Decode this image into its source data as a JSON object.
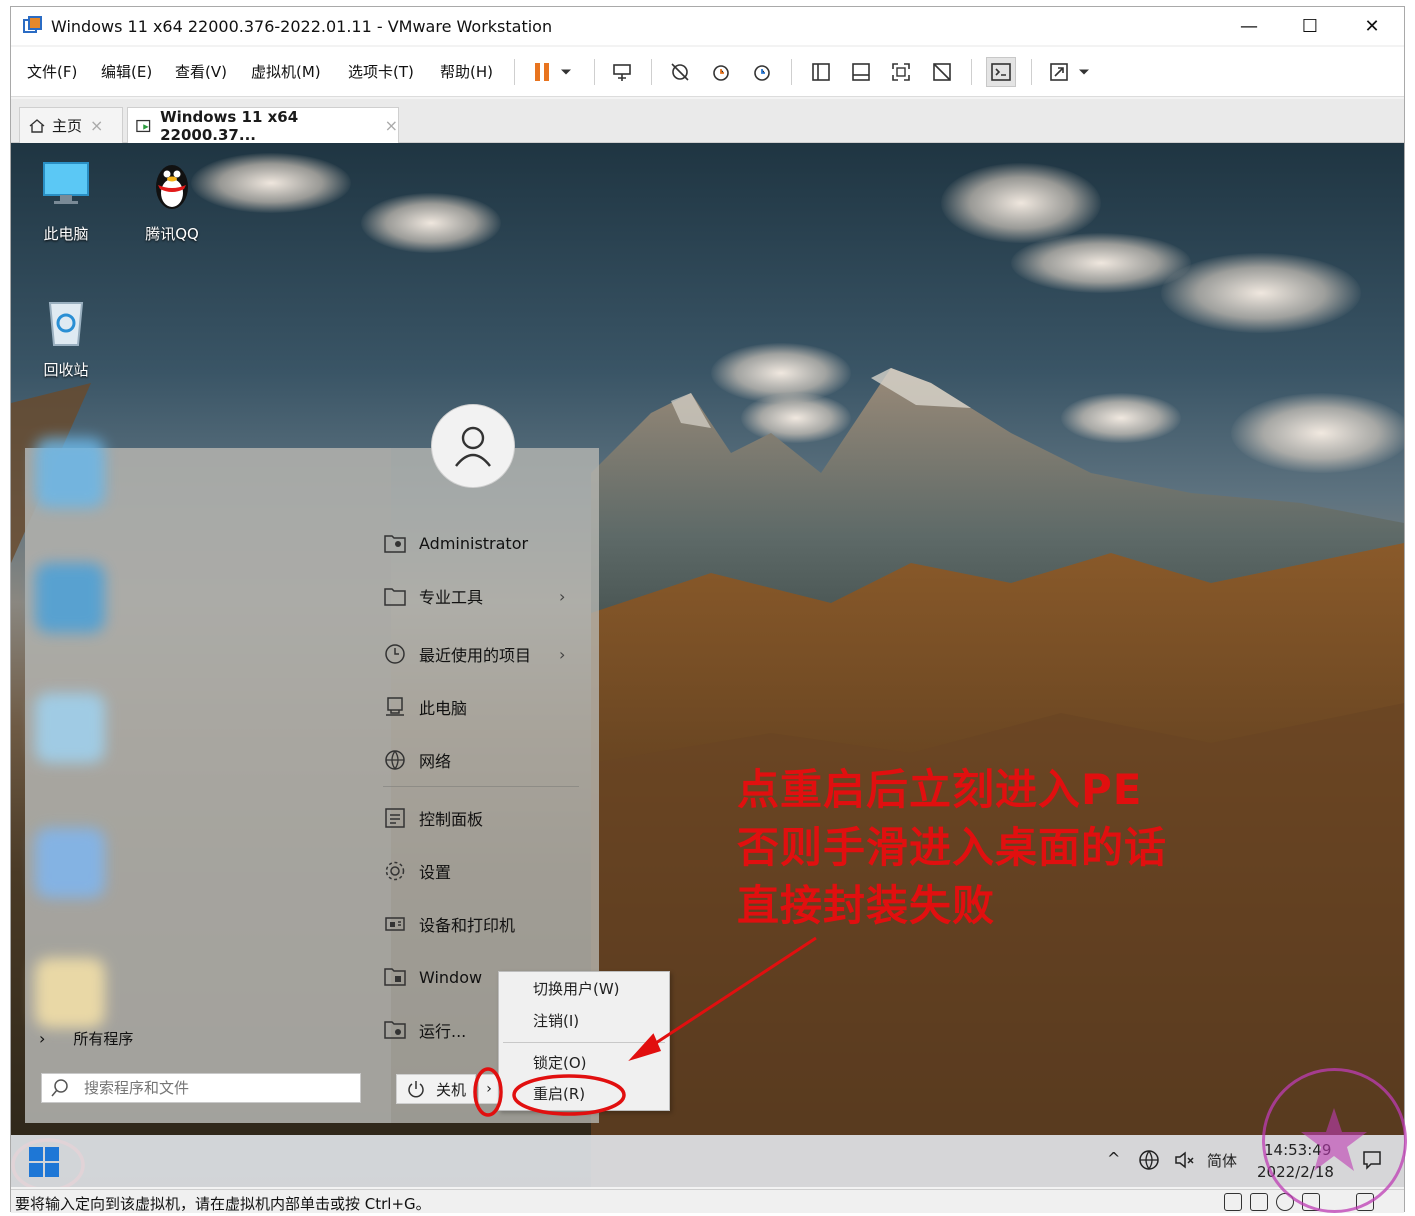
{
  "window": {
    "title": "Windows 11 x64 22000.376-2022.01.11 - VMware Workstation",
    "controls": {
      "minimize": "—",
      "maximize": "☐",
      "close": "✕"
    }
  },
  "menu": {
    "items": [
      "文件(F)",
      "编辑(E)",
      "查看(V)",
      "虚拟机(M)",
      "选项卡(T)",
      "帮助(H)"
    ]
  },
  "tabs": [
    {
      "label": "主页",
      "close": "×"
    },
    {
      "label": "Windows 11 x64 22000.37...",
      "close": "×"
    }
  ],
  "desktop": {
    "icons": [
      "此电脑",
      "腾讯QQ",
      "回收站"
    ]
  },
  "start_menu": {
    "items": [
      {
        "label": "Administrator",
        "icon": "user-folder-icon",
        "chevron": ""
      },
      {
        "label": "专业工具",
        "icon": "folder-icon",
        "chevron": "›"
      },
      {
        "label": "最近使用的项目",
        "icon": "clock-icon",
        "chevron": "›"
      },
      {
        "label": "此电脑",
        "icon": "computer-icon",
        "chevron": ""
      },
      {
        "label": "网络",
        "icon": "network-icon",
        "chevron": ""
      },
      {
        "label": "控制面板",
        "icon": "control-panel-icon",
        "chevron": ""
      },
      {
        "label": "设置",
        "icon": "gear-icon",
        "chevron": ""
      },
      {
        "label": "设备和打印机",
        "icon": "printer-icon",
        "chevron": ""
      },
      {
        "label": "Window",
        "icon": "windows-tools-icon",
        "chevron": ""
      },
      {
        "label": "运行...",
        "icon": "run-icon",
        "chevron": ""
      }
    ],
    "all_programs": "所有程序",
    "search_placeholder": "搜索程序和文件",
    "shutdown_label": "关机",
    "shutdown_arrow": "›"
  },
  "power_menu": {
    "items": [
      "切换用户(W)",
      "注销(I)",
      "锁定(O)",
      "重启(R)"
    ]
  },
  "annotation": {
    "lines": [
      "点重启后立刻进入PE",
      "否则手滑进入桌面的话",
      "直接封装失败"
    ],
    "color": "#e10f0f"
  },
  "taskbar": {
    "ime": "简体",
    "time": "14:53:49",
    "date": "2022/2/18"
  },
  "status": {
    "message": "要将输入定向到该虚拟机，请在虚拟机内部单击或按 Ctrl+G。"
  }
}
